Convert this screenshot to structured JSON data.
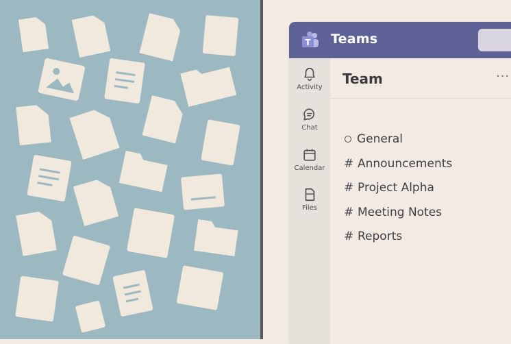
{
  "app": {
    "title": "Teams",
    "logo_icon": "teams-logo-icon"
  },
  "rail": {
    "items": [
      {
        "label": "Activity",
        "icon": "bell-icon"
      },
      {
        "label": "Chat",
        "icon": "chat-bubble-icon"
      },
      {
        "label": "Calendar",
        "icon": "calendar-icon"
      },
      {
        "label": "Files",
        "icon": "file-icon"
      }
    ]
  },
  "main": {
    "header": "Team",
    "more_label": "···",
    "channels": [
      {
        "prefix": "circle",
        "name": "General"
      },
      {
        "prefix": "#",
        "name": "Announcements"
      },
      {
        "prefix": "#",
        "name": "Project Alpha"
      },
      {
        "prefix": "#",
        "name": "Meeting Notes"
      },
      {
        "prefix": "#",
        "name": "Reports"
      }
    ]
  },
  "colors": {
    "titlebar": "#5f6296",
    "left_panel": "#9cb8c0",
    "paper": "#f3ebe3",
    "icon_shape": "#f1e8de"
  }
}
